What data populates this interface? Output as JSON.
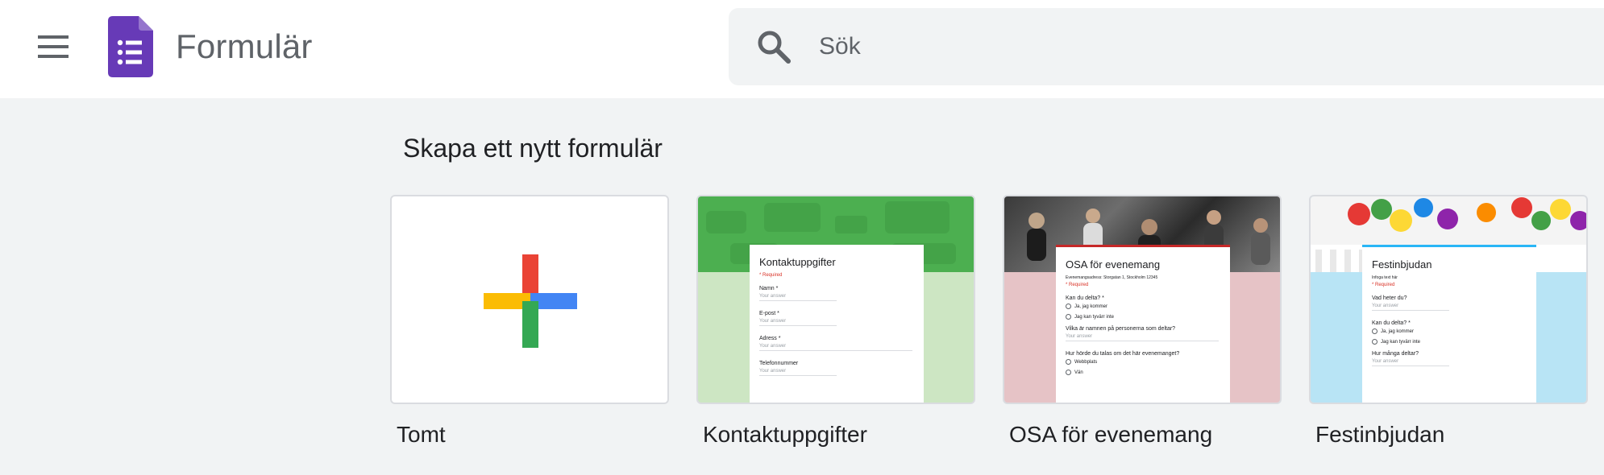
{
  "app": {
    "title": "Formulär"
  },
  "search": {
    "placeholder": "Sök"
  },
  "section": {
    "title": "Skapa ett nytt formulär"
  },
  "templates": [
    {
      "label": "Tomt"
    },
    {
      "label": "Kontaktuppgifter",
      "preview": {
        "title": "Kontaktuppgifter",
        "required_note": "* Required",
        "fields": [
          "Namn *",
          "E-post *",
          "Adress *",
          "Telefonnummer"
        ],
        "answer_hint": "Your answer"
      }
    },
    {
      "label": "OSA för evenemang",
      "preview": {
        "title": "OSA för evenemang",
        "description": "Evenemangsadress: Storgatan 1, Stockholm 12345",
        "required_note": "* Required",
        "q1": "Kan du delta? *",
        "options1": [
          "Ja, jag kommer",
          "Jag kan tyvärr inte"
        ],
        "q2": "Vilka är namnen på personerna som deltar?",
        "answer_hint": "Your answer",
        "q3": "Hur hörde du talas om det här evenemanget?",
        "options3": [
          "Webbplats",
          "Vän"
        ]
      }
    },
    {
      "label": "Festinbjudan",
      "preview": {
        "title": "Festinbjudan",
        "description": "Infoga text här",
        "required_note": "* Required",
        "q1": "Vad heter du?",
        "answer_hint": "Your answer",
        "q2": "Kan du delta? *",
        "options2": [
          "Ja, jag kommer",
          "Jag kan tyvärr inte"
        ],
        "q3": "Hur många deltar?"
      }
    }
  ],
  "colors": {
    "forms_purple": "#673ab7",
    "google_red": "#ea4335",
    "google_blue": "#4285f4",
    "google_green": "#34a853",
    "google_yellow": "#fbbc04"
  },
  "icons": {
    "menu": "hamburger-menu-icon",
    "search": "search-icon",
    "logo": "forms-logo-icon",
    "plus": "multicolor-plus-icon"
  }
}
